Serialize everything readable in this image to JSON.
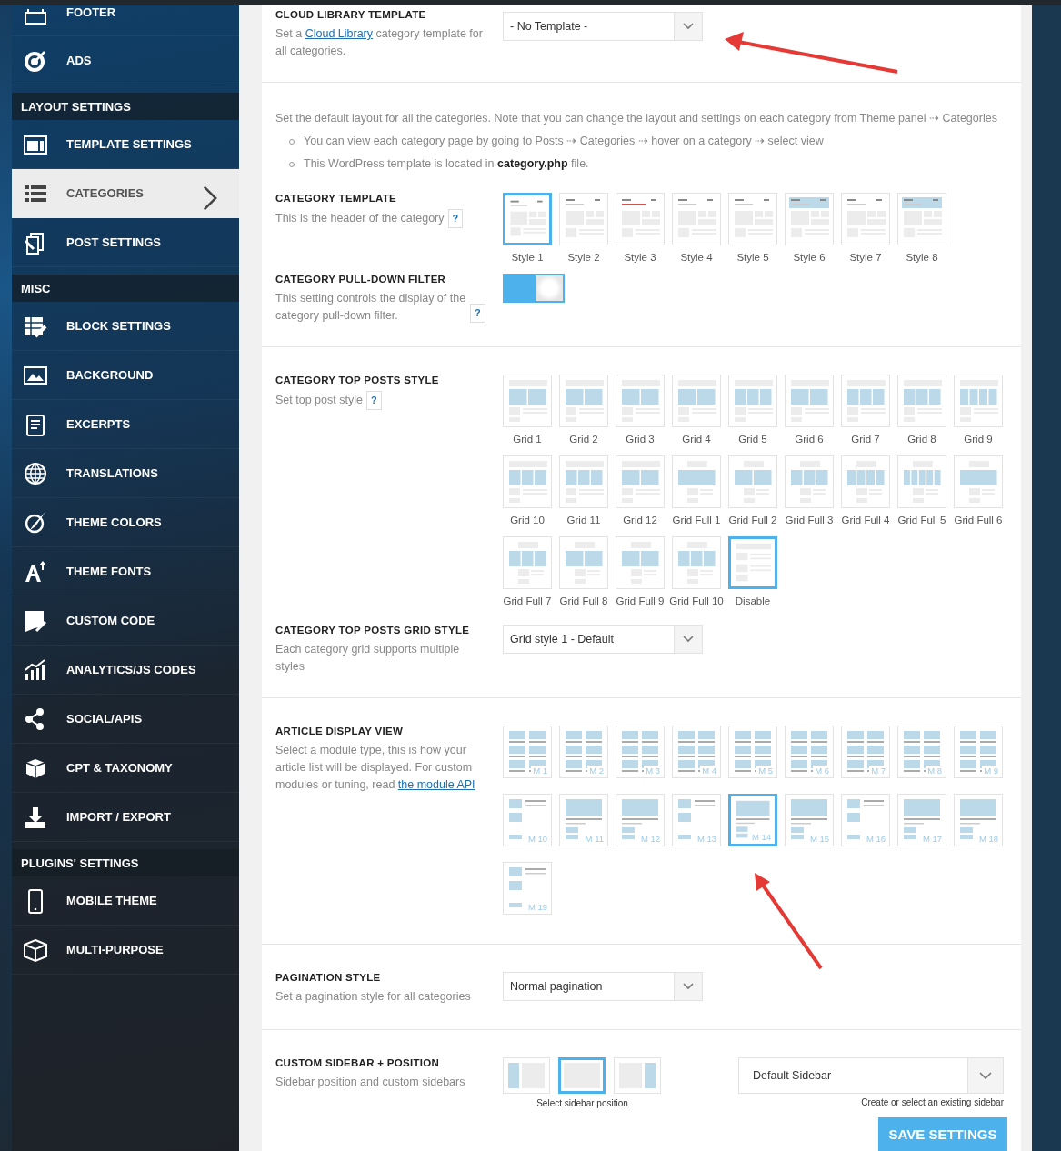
{
  "sidebar": {
    "groups": [
      {
        "items": [
          {
            "label": "FOOTER",
            "selected": false
          },
          {
            "label": "ADS",
            "selected": false
          }
        ]
      },
      {
        "heading": "LAYOUT SETTINGS",
        "items": [
          {
            "label": "TEMPLATE SETTINGS",
            "selected": false
          },
          {
            "label": "CATEGORIES",
            "selected": true
          },
          {
            "label": "POST SETTINGS",
            "selected": false
          }
        ]
      },
      {
        "heading": "MISC",
        "items": [
          {
            "label": "BLOCK SETTINGS",
            "selected": false
          },
          {
            "label": "BACKGROUND",
            "selected": false
          },
          {
            "label": "EXCERPTS",
            "selected": false
          },
          {
            "label": "TRANSLATIONS",
            "selected": false
          },
          {
            "label": "THEME COLORS",
            "selected": false
          },
          {
            "label": "THEME FONTS",
            "selected": false
          },
          {
            "label": "CUSTOM CODE",
            "selected": false
          },
          {
            "label": "ANALYTICS/JS CODES",
            "selected": false
          },
          {
            "label": "SOCIAL/APIS",
            "selected": false
          },
          {
            "label": "CPT & TAXONOMY",
            "selected": false
          },
          {
            "label": "IMPORT / EXPORT",
            "selected": false
          }
        ]
      },
      {
        "heading": "PLUGINS' SETTINGS",
        "items": [
          {
            "label": "MOBILE THEME",
            "selected": false
          },
          {
            "label": "MULTI-PURPOSE",
            "selected": false
          }
        ]
      }
    ]
  },
  "cloud_library": {
    "title": "CLOUD LIBRARY TEMPLATE",
    "text_before": "Set a ",
    "link": "Cloud Library",
    "text_after": " category template for all categories.",
    "dropdown": {
      "value": "- No Template -"
    }
  },
  "intro": {
    "text": "Set the default layout for all the categories. Note that you can change the layout and settings on each category from Theme panel ⇢ Categories",
    "bullets": [
      "You can view each category page by going to Posts ⇢ Categories ⇢ hover on a category ⇢ select view",
      "This WordPress template is located in **category.php** file."
    ]
  },
  "category_template": {
    "title": "CATEGORY TEMPLATE",
    "description": "This is the header of the category",
    "help": "?",
    "options": [
      {
        "label": "Style 1",
        "selected": true
      },
      {
        "label": "Style 2",
        "selected": false
      },
      {
        "label": "Style 3",
        "selected": false
      },
      {
        "label": "Style 4",
        "selected": false
      },
      {
        "label": "Style 5",
        "selected": false
      },
      {
        "label": "Style 6",
        "selected": false
      },
      {
        "label": "Style 7",
        "selected": false
      },
      {
        "label": "Style 8",
        "selected": false
      }
    ]
  },
  "pull_down_filter": {
    "title": "CATEGORY PULL-DOWN FILTER",
    "description": "This setting controls the display of the category pull-down filter.",
    "help": "?",
    "toggle": {
      "on": true
    }
  },
  "top_posts_style": {
    "title": "CATEGORY TOP POSTS STYLE",
    "description": "Set top post style",
    "help": "?",
    "options": [
      {
        "label": "Grid 1",
        "selected": false
      },
      {
        "label": "Grid 2",
        "selected": false
      },
      {
        "label": "Grid 3",
        "selected": false
      },
      {
        "label": "Grid 4",
        "selected": false
      },
      {
        "label": "Grid 5",
        "selected": false
      },
      {
        "label": "Grid 6",
        "selected": false
      },
      {
        "label": "Grid 7",
        "selected": false
      },
      {
        "label": "Grid 8",
        "selected": false
      },
      {
        "label": "Grid 9",
        "selected": false
      },
      {
        "label": "Grid 10",
        "selected": false
      },
      {
        "label": "Grid 11",
        "selected": false
      },
      {
        "label": "Grid 12",
        "selected": false
      },
      {
        "label": "Grid Full 1",
        "selected": false
      },
      {
        "label": "Grid Full 2",
        "selected": false
      },
      {
        "label": "Grid Full 3",
        "selected": false
      },
      {
        "label": "Grid Full 4",
        "selected": false
      },
      {
        "label": "Grid Full 5",
        "selected": false
      },
      {
        "label": "Grid Full 6",
        "selected": false
      },
      {
        "label": "Grid Full 7",
        "selected": false
      },
      {
        "label": "Grid Full 8",
        "selected": false
      },
      {
        "label": "Grid Full 9",
        "selected": false
      },
      {
        "label": "Grid Full 10",
        "selected": false
      },
      {
        "label": "Disable",
        "selected": true
      }
    ]
  },
  "top_posts_grid_style": {
    "title": "CATEGORY TOP POSTS GRID STYLE",
    "description": "Each category grid supports multiple styles",
    "dropdown": {
      "value": "Grid style 1 - Default"
    }
  },
  "article_display_view": {
    "title": "ARTICLE DISPLAY VIEW",
    "text_before": "Select a module type, this is how your article list will be displayed. For custom modules or tuning, read ",
    "link": "the module API",
    "options": [
      {
        "label": "M 1",
        "selected": false
      },
      {
        "label": "M 2",
        "selected": false
      },
      {
        "label": "M 3",
        "selected": false
      },
      {
        "label": "M 4",
        "selected": false
      },
      {
        "label": "M 5",
        "selected": false
      },
      {
        "label": "M 6",
        "selected": false
      },
      {
        "label": "M 7",
        "selected": false
      },
      {
        "label": "M 8",
        "selected": false
      },
      {
        "label": "M 9",
        "selected": false
      },
      {
        "label": "M 10",
        "selected": false
      },
      {
        "label": "M 11",
        "selected": false
      },
      {
        "label": "M 12",
        "selected": false
      },
      {
        "label": "M 13",
        "selected": false
      },
      {
        "label": "M 14",
        "selected": true
      },
      {
        "label": "M 15",
        "selected": false
      },
      {
        "label": "M 16",
        "selected": false
      },
      {
        "label": "M 17",
        "selected": false
      },
      {
        "label": "M 18",
        "selected": false
      },
      {
        "label": "M 19",
        "selected": false
      }
    ]
  },
  "pagination_style": {
    "title": "PAGINATION STYLE",
    "description": "Set a pagination style for all categories",
    "dropdown": {
      "value": "Normal pagination"
    }
  },
  "custom_sidebar": {
    "title": "CUSTOM SIDEBAR + POSITION",
    "description": "Sidebar position and custom sidebars",
    "positions": [
      {
        "kind": "left",
        "selected": false
      },
      {
        "kind": "none",
        "selected": true
      },
      {
        "kind": "right",
        "selected": false
      }
    ],
    "caption": "Select sidebar position",
    "dropdown": {
      "value": "Default Sidebar"
    },
    "hint": "Create or select an existing sidebar"
  },
  "save_button": "SAVE SETTINGS"
}
